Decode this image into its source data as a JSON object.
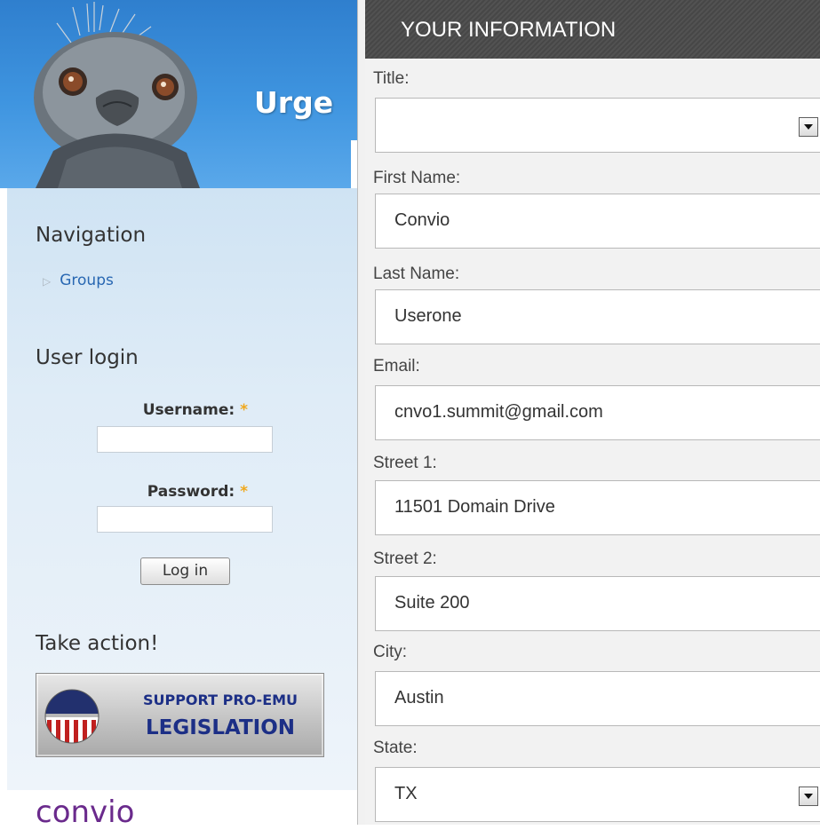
{
  "site": {
    "title": "Urge"
  },
  "sidebar": {
    "navigation": {
      "title": "Navigation",
      "items": [
        {
          "label": "Groups"
        }
      ]
    },
    "login": {
      "title": "User login",
      "username_label": "Username:",
      "password_label": "Password:",
      "required_mark": "*",
      "button_label": "Log in"
    },
    "action": {
      "title": "Take action!",
      "banner_line1": "SUPPORT PRO-EMU",
      "banner_line2": "LEGISLATION"
    },
    "footer_brand": "convio"
  },
  "form": {
    "header": "YOUR INFORMATION",
    "fields": [
      {
        "label": "Title:",
        "value": "",
        "type": "select"
      },
      {
        "label": "First Name:",
        "value": "Convio",
        "type": "text"
      },
      {
        "label": "Last Name:",
        "value": "Userone",
        "type": "text"
      },
      {
        "label": "Email:",
        "value": "cnvo1.summit@gmail.com",
        "type": "text"
      },
      {
        "label": "Street 1:",
        "value": "11501 Domain Drive",
        "type": "text"
      },
      {
        "label": "Street 2:",
        "value": "Suite 200",
        "type": "text"
      },
      {
        "label": "City:",
        "value": "Austin",
        "type": "text"
      },
      {
        "label": "State:",
        "value": "TX",
        "type": "select"
      }
    ]
  },
  "colors": {
    "banner_blue": "#3f95e0",
    "link": "#2867b2",
    "required": "#f0a81c",
    "brand_purple": "#6a2a8c",
    "panel_header": "#4d4d4d"
  }
}
